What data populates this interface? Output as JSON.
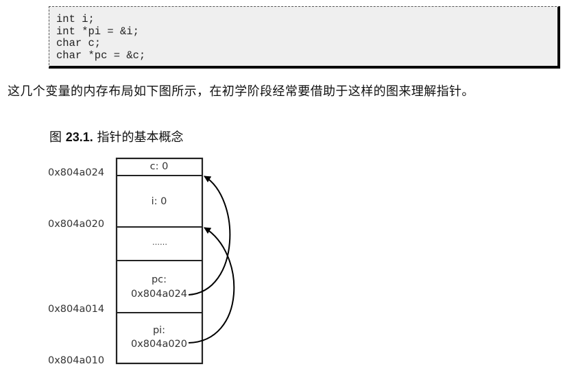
{
  "code_block": {
    "lines": [
      "int i;",
      "int *pi = &i;",
      "char c;",
      "char *pc = &c;"
    ]
  },
  "paragraph": "这几个变量的内存布局如下图所示，在初学阶段经常要借助于这样的图来理解指针。",
  "figure": {
    "label_prefix": "图 ",
    "number": "23.1.",
    "caption": " 指针的基本概念",
    "addresses": [
      "0x804a024",
      "0x804a020",
      "0x804a014",
      "0x804a010"
    ],
    "cells": {
      "c": "c: 0",
      "i": "i: 0",
      "gap": "……",
      "pc_name": "pc:",
      "pc_value": "0x804a024",
      "pi_name": "pi:",
      "pi_value": "0x804a020"
    }
  }
}
